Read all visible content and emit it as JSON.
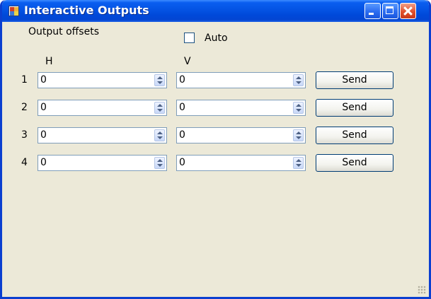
{
  "window": {
    "title": "Interactive Outputs",
    "icon": "app-window-icon"
  },
  "labels": {
    "output_offsets": "Output offsets",
    "auto": "Auto",
    "col_h": "H",
    "col_v": "V"
  },
  "auto_checked": false,
  "rows": [
    {
      "num": "1",
      "h": "0",
      "v": "0",
      "send": "Send"
    },
    {
      "num": "2",
      "h": "0",
      "v": "0",
      "send": "Send"
    },
    {
      "num": "3",
      "h": "0",
      "v": "0",
      "send": "Send"
    },
    {
      "num": "4",
      "h": "0",
      "v": "0",
      "send": "Send"
    }
  ],
  "colors": {
    "title_bar": "#0453e3",
    "client_bg": "#ece9d8",
    "input_border": "#7f9db9",
    "button_border": "#003c74"
  }
}
